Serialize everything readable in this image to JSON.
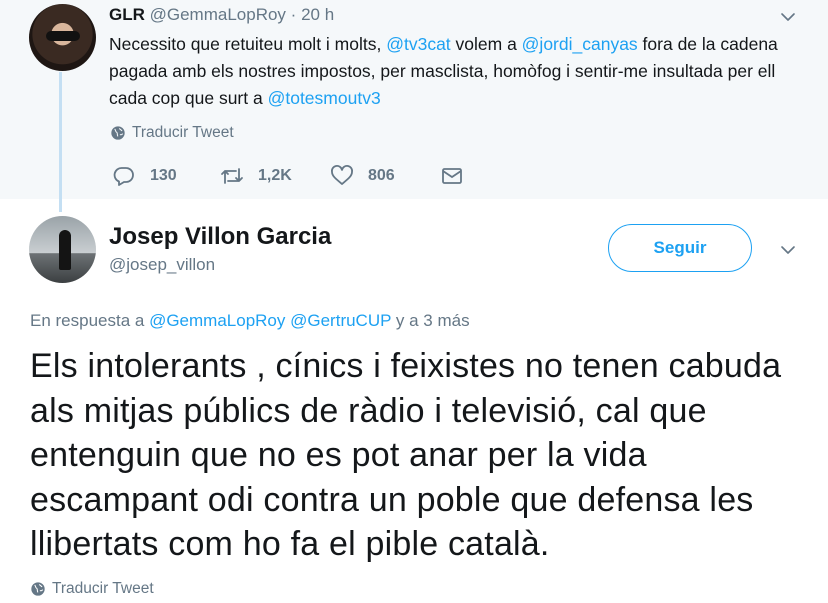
{
  "parent_tweet": {
    "name": "GLR",
    "handle": "@GemmaLopRoy",
    "dot": "·",
    "time": "20 h",
    "text_parts": {
      "t1": "Necessito que retuiteu molt i molts, ",
      "m1": "@tv3cat",
      "t2": " volem a ",
      "m2": "@jordi_canyas",
      "t3": " fora de la cadena pagada amb els nostres impostos, per masclista, homòfog i sentir-me insultada per ell cada cop que surt a ",
      "m3": "@totesmoutv3"
    },
    "translate_label": "Traducir Tweet",
    "stats": {
      "replies": "130",
      "retweets": "1,2K",
      "likes": "806"
    }
  },
  "main_tweet": {
    "name": "Josep Villon Garcia",
    "handle": "@josep_villon",
    "follow_label": "Seguir",
    "reply_prefix": "En respuesta a ",
    "reply_mention1": "@GemmaLopRoy",
    "reply_space": " ",
    "reply_mention2": "@GertruCUP",
    "reply_suffix": " y a 3 más",
    "text": "Els intolerants , cínics i feixistes no tenen cabuda als mitjas públics de ràdio i televisió, cal que entenguin que no es pot anar per la vida escampant odi contra un poble que defensa les llibertats com ho fa el pible català.",
    "translate_label": "Traducir Tweet"
  },
  "icons": {
    "caret": "chevron-down-icon",
    "globe": "globe-icon",
    "reply": "reply-icon",
    "retweet": "retweet-icon",
    "like": "heart-icon",
    "message": "envelope-icon"
  },
  "colors": {
    "accent": "#1da1f2",
    "muted": "#657786",
    "thread": "#c4dff3",
    "parent_bg": "#f5f8fa"
  }
}
